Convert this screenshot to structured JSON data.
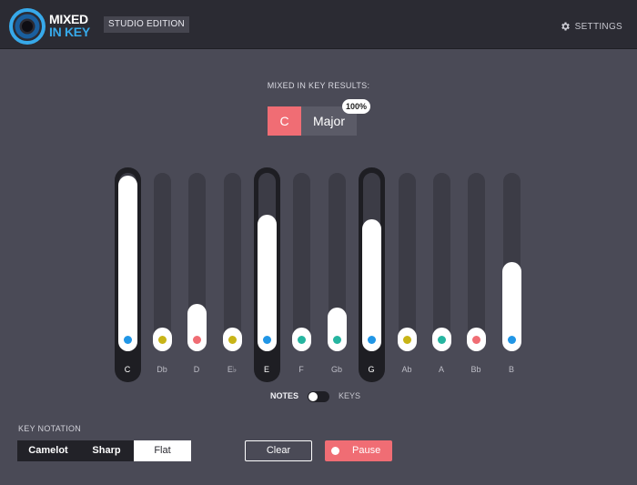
{
  "header": {
    "brand_line1": "MIXED",
    "brand_line2": "IN KEY",
    "edition": "STUDIO EDITION",
    "settings_label": "SETTINGS"
  },
  "results": {
    "label": "MIXED IN KEY RESULTS:",
    "note": "C",
    "mode": "Major",
    "confidence": "100%"
  },
  "notes": [
    {
      "label": "C",
      "level": 0.97,
      "dot": "#2196e6",
      "highlight": true
    },
    {
      "label": "Db",
      "level": 0.0,
      "dot": "#c8b417",
      "highlight": false
    },
    {
      "label": "D",
      "level": 0.15,
      "dot": "#f06d74",
      "highlight": false
    },
    {
      "label": "E♭",
      "level": 0.0,
      "dot": "#c8b417",
      "highlight": false
    },
    {
      "label": "E",
      "level": 0.72,
      "dot": "#2196e6",
      "highlight": true
    },
    {
      "label": "F",
      "level": 0.0,
      "dot": "#26b5a0",
      "highlight": false
    },
    {
      "label": "Gb",
      "level": 0.13,
      "dot": "#26b5a0",
      "highlight": false
    },
    {
      "label": "G",
      "level": 0.69,
      "dot": "#2196e6",
      "highlight": true
    },
    {
      "label": "Ab",
      "level": 0.0,
      "dot": "#c8b417",
      "highlight": false
    },
    {
      "label": "A",
      "level": 0.0,
      "dot": "#26b5a0",
      "highlight": false
    },
    {
      "label": "Bb",
      "level": 0.0,
      "dot": "#f06d74",
      "highlight": false
    },
    {
      "label": "B",
      "level": 0.42,
      "dot": "#2196e6",
      "highlight": false
    }
  ],
  "toggle": {
    "left": "NOTES",
    "right": "KEYS",
    "state": "NOTES"
  },
  "key_notation": {
    "label": "KEY NOTATION",
    "options": [
      "Camelot",
      "Sharp",
      "Flat"
    ],
    "selected": "Flat"
  },
  "controls": {
    "clear": "Clear",
    "pause": "Pause"
  },
  "colors": {
    "accent": "#f06d74",
    "brand_blue": "#37a9ea",
    "background": "#4a4a56",
    "header": "#2b2b33"
  }
}
